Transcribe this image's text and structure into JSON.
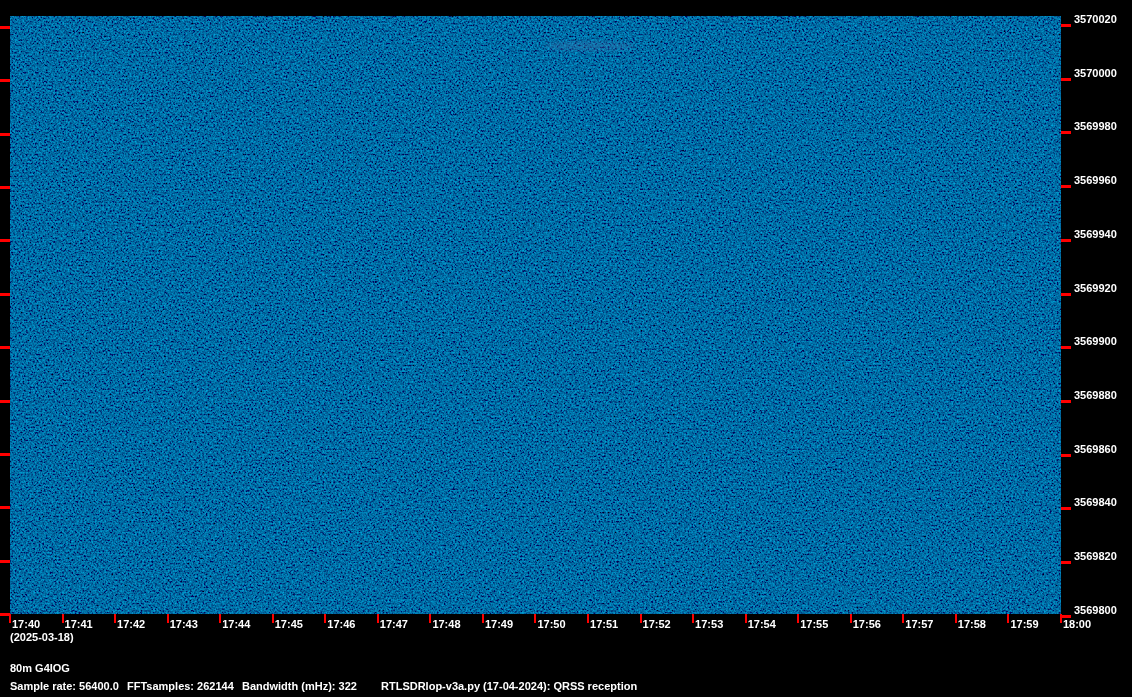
{
  "spectrogram": {
    "frequency_labels": [
      "3570020",
      "3570000",
      "3569980",
      "3569960",
      "3569940",
      "3569920",
      "3569900",
      "3569880",
      "3569860",
      "3569840",
      "3569820",
      "3569800"
    ],
    "time_labels": [
      "17:40",
      "17:41",
      "17:42",
      "17:43",
      "17:44",
      "17:45",
      "17:46",
      "17:47",
      "17:48",
      "17:49",
      "17:50",
      "17:51",
      "17:52",
      "17:53",
      "17:54",
      "17:55",
      "17:56",
      "17:57",
      "17:58",
      "17:59",
      "18:00"
    ]
  },
  "date": "(2025-03-18)",
  "station": "80m G4IOG",
  "info": [
    "Sample rate: 56400.0",
    "FFTsamples: 262144",
    "Bandwidth (mHz): 322",
    "RTLSDRlop-v3a.py (17-04-2024): QRSS reception"
  ]
}
